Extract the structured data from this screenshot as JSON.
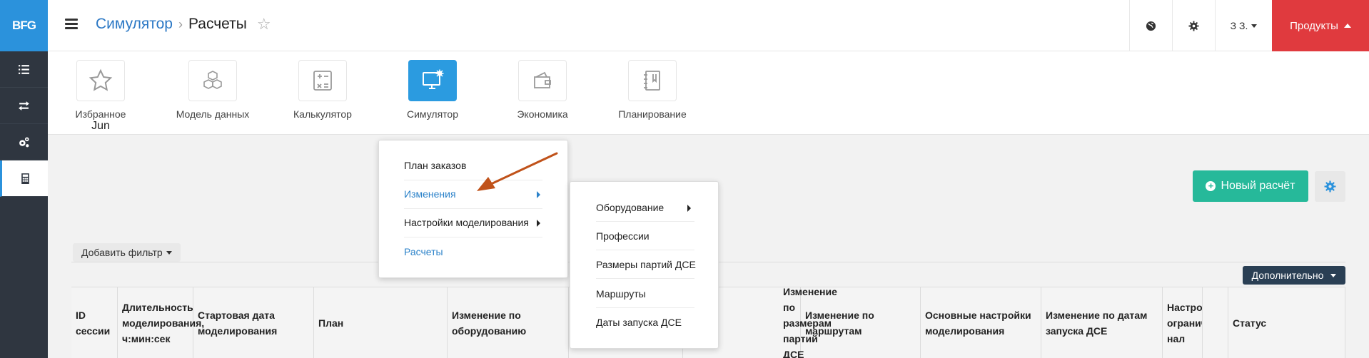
{
  "logo": "BFG",
  "header": {
    "breadcrumb_root": "Симулятор",
    "breadcrumb_current": "Расчеты",
    "user_label": "З З.",
    "products_label": "Продукты"
  },
  "tiles": [
    {
      "label": "Избранное"
    },
    {
      "label": "Модель данных"
    },
    {
      "label": "Калькулятор"
    },
    {
      "label": "Симулятор"
    },
    {
      "label": "Экономика"
    },
    {
      "label": "Планирование"
    }
  ],
  "menu_main": [
    {
      "label": "План заказов"
    },
    {
      "label": "Изменения"
    },
    {
      "label": "Настройки моделирования"
    },
    {
      "label": "Расчеты"
    }
  ],
  "menu_sub": [
    {
      "label": "Оборудование"
    },
    {
      "label": "Профессии"
    },
    {
      "label": "Размеры партий ДСЕ"
    },
    {
      "label": "Маршруты"
    },
    {
      "label": "Даты запуска ДСЕ"
    }
  ],
  "toolbar": {
    "add_filter": "Добавить фильтр",
    "new_calc": "Новый расчёт",
    "more": "Дополнительно"
  },
  "table": {
    "columns": [
      "ID сессии",
      "Длительность моделирования, ч:мин:сек",
      "Стартовая дата моделирования",
      "План",
      "Изменение по оборудованию",
      "",
      "Изменение по размерам партий ДСЕ",
      "Изменение по маршрутам",
      "Основные настройки моделирования",
      "Изменение по датам запуска ДСЕ",
      "Настройки ограничений нал",
      "Статус"
    ]
  },
  "colors": {
    "sidebar": "#2f3640",
    "accent_blue": "#2b92dc",
    "products_red": "#e03a3e",
    "new_calc_green": "#26b99a",
    "more_btn": "#2a3f54",
    "annotation_arrow": "#c0521a"
  }
}
